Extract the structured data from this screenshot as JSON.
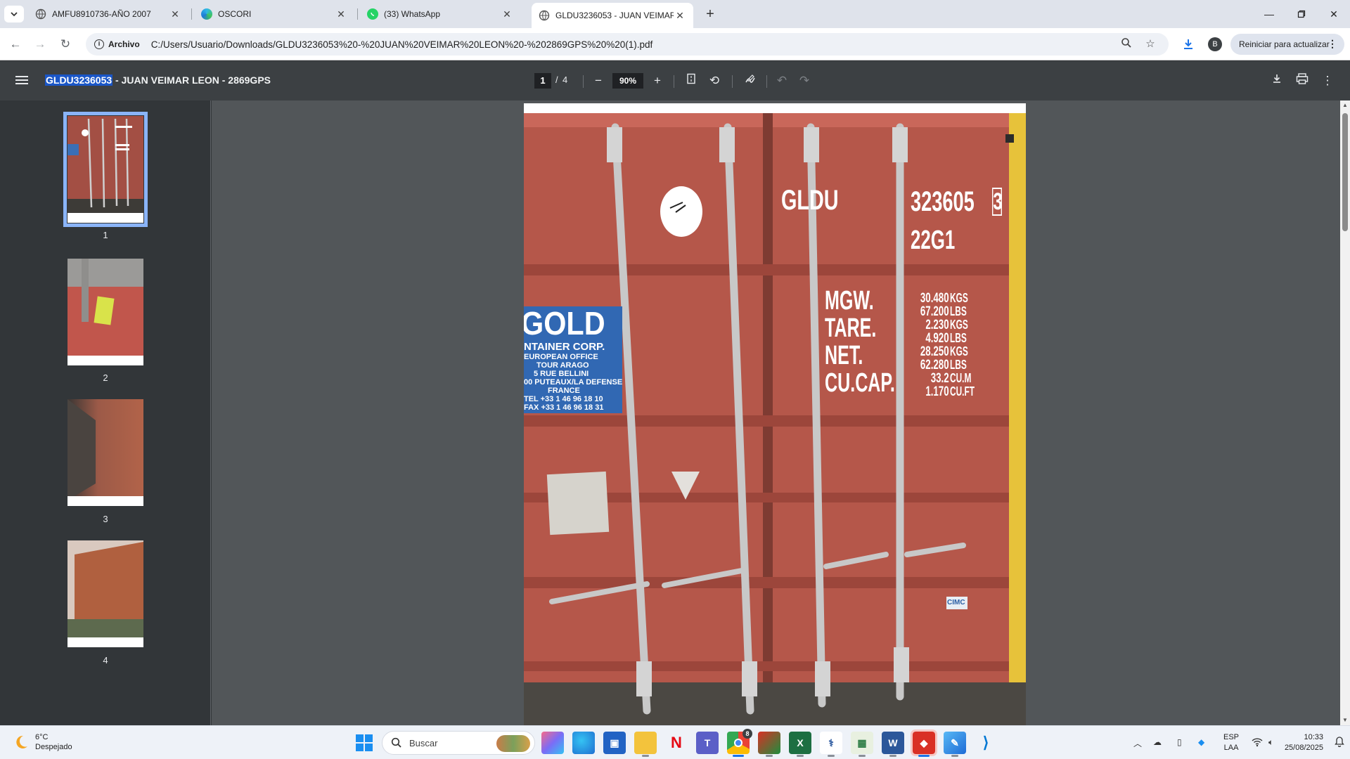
{
  "browser": {
    "tabs": [
      {
        "title": "AMFU8910736-AÑO 2007",
        "icon": "globe-icon",
        "active": false
      },
      {
        "title": "OSCORI",
        "icon": "edge-swirl-icon",
        "active": false
      },
      {
        "title": "(33) WhatsApp",
        "icon": "whatsapp-icon",
        "active": false
      },
      {
        "title": "GLDU3236053 - JUAN VEIMAR",
        "icon": "globe-icon",
        "active": true
      }
    ],
    "new_tab_label": "+",
    "address": {
      "site_chip": "Archivo",
      "url": "C:/Users/Usuario/Downloads/GLDU3236053%20-%20JUAN%20VEIMAR%20LEON%20-%202869GPS%20%20(1).pdf"
    },
    "profile_initial": "B",
    "update_button": "Reiniciar para actualizar"
  },
  "pdf_viewer": {
    "title_highlight": "GLDU3236053",
    "title_rest": " - JUAN VEIMAR LEON - 2869GPS",
    "current_page": "1",
    "page_separator": "/",
    "total_pages": "4",
    "zoom": "90%",
    "thumbnails": [
      {
        "label": "1",
        "selected": true
      },
      {
        "label": "2",
        "selected": false
      },
      {
        "label": "3",
        "selected": false
      },
      {
        "label": "4",
        "selected": false
      }
    ]
  },
  "photo_text": {
    "container_prefix": "GLDU",
    "container_number": "323605",
    "check_digit": "3",
    "type_code": "22G1",
    "spec_labels": [
      "MGW.",
      "TARE.",
      "NET.",
      "CU.CAP."
    ],
    "spec_values": [
      "30.480",
      "67.200",
      "2.230",
      "4.920",
      "28.250",
      "62.280",
      "33.2",
      "1.170"
    ],
    "spec_units": [
      "KGS",
      "LBS",
      "KGS",
      "LBS",
      "KGS",
      "LBS",
      "CU.M",
      "CU.FT"
    ],
    "sticker_brand": "GOLD",
    "sticker_lines": [
      "NTAINER CORP.",
      "EUROPEAN OFFICE",
      "TOUR ARAGO",
      "5 RUE BELLINI",
      "00 PUTEAUX/LA DEFENSE",
      "FRANCE",
      "TEL +33 1 46 96 18 10",
      "FAX +33 1 46 96 18 31"
    ],
    "maker_tag": "CIMC"
  },
  "taskbar": {
    "weather_temp": "6°C",
    "weather_desc": "Despejado",
    "search_placeholder": "Buscar",
    "lang_top": "ESP",
    "lang_bottom": "LAA",
    "time": "10:33",
    "date": "25/08/2025",
    "chrome_badge": "8"
  },
  "colors": {
    "container_red": "#b5574a",
    "toolbar_dark": "#3c4043",
    "viewer_bg": "#525659",
    "selection_blue": "#1a56c7"
  }
}
